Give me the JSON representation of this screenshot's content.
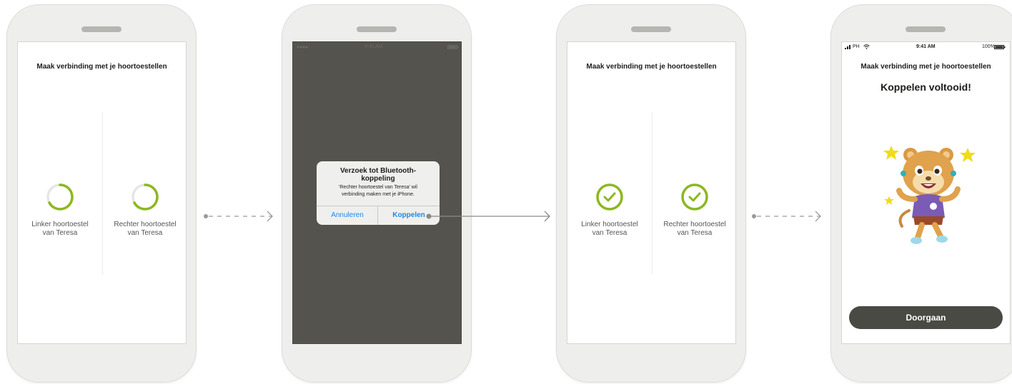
{
  "screens": {
    "pairing_title": "Maak verbinding met je hoortoestellen",
    "left_aid_line1": "Linker hoortoestel",
    "left_aid_line2": "van Teresa",
    "right_aid_line1": "Rechter hoortoestel",
    "right_aid_line2": "van Teresa"
  },
  "dialog": {
    "title": "Verzoek tot Bluetooth-koppeling",
    "message": "'Rechter hoortoestel van Teresa' wil verbinding maken met je iPhone.",
    "cancel_label": "Annuleren",
    "pair_label": "Koppelen",
    "status_time": "9:41 AM"
  },
  "complete": {
    "status_carrier": "PH",
    "status_time": "9:41 AM",
    "status_battery": "100%",
    "heading": "Koppelen voltooid!",
    "continue_label": "Doorgaan"
  },
  "colors": {
    "accent_green": "#8cb81f",
    "dialog_blue": "#1e88e5",
    "overlay_gray": "#54534d",
    "button_dark": "#4a4a44"
  },
  "icons": [
    "progress-ring-icon",
    "checkmark-icon",
    "dashed-arrow-icon",
    "solid-arrow-icon",
    "lion-mascot-icon",
    "star-icon",
    "signal-icon",
    "wifi-icon",
    "battery-icon"
  ]
}
